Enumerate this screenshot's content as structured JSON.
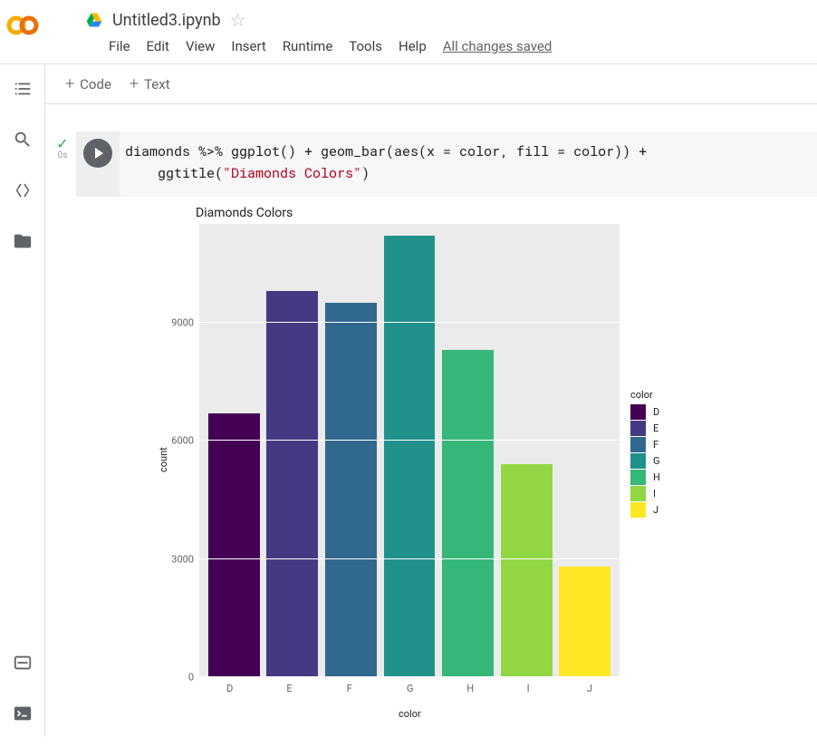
{
  "header": {
    "notebook_title": "Untitled3.ipynb",
    "menu": [
      "File",
      "Edit",
      "View",
      "Insert",
      "Runtime",
      "Tools",
      "Help"
    ],
    "save_status": "All changes saved"
  },
  "toolbar": {
    "code_label": "Code",
    "text_label": "Text"
  },
  "cell": {
    "exec_time": "0s",
    "code_plain_prefix": "diamonds %>% ggplot() + geom_bar(aes(x = color, fill = color)) + \n    ggtitle(",
    "code_string": "\"Diamonds Colors\"",
    "code_plain_suffix": ")"
  },
  "chart_data": {
    "type": "bar",
    "title": "Diamonds Colors",
    "xlabel": "color",
    "ylabel": "count",
    "y_ticks": [
      0,
      3000,
      6000,
      9000
    ],
    "ymax": 11500,
    "legend_title": "color",
    "series": [
      {
        "name": "D",
        "value": 6700,
        "color": "#440154"
      },
      {
        "name": "E",
        "value": 9800,
        "color": "#443a83"
      },
      {
        "name": "F",
        "value": 9500,
        "color": "#31688e"
      },
      {
        "name": "G",
        "value": 11200,
        "color": "#21918c"
      },
      {
        "name": "H",
        "value": 8300,
        "color": "#35b779"
      },
      {
        "name": "I",
        "value": 5400,
        "color": "#90d743"
      },
      {
        "name": "J",
        "value": 2800,
        "color": "#fde725"
      }
    ]
  }
}
